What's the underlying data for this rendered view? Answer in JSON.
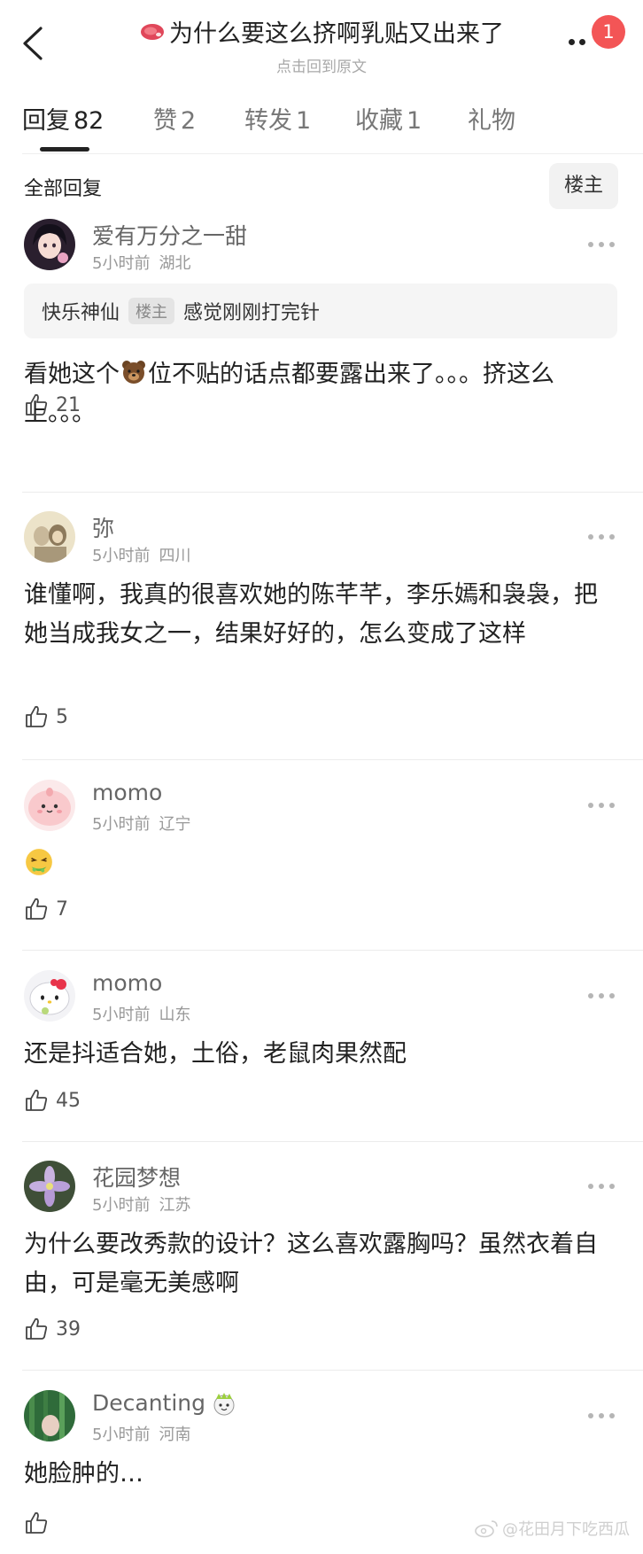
{
  "header": {
    "title": "为什么要这么挤啊乳贴又出来了",
    "subtitle": "点击回到原文",
    "notification_count": "1"
  },
  "tabs": [
    {
      "label": "回复",
      "count": "82"
    },
    {
      "label": "赞",
      "count": "2"
    },
    {
      "label": "转发",
      "count": "1"
    },
    {
      "label": "收藏",
      "count": "1"
    },
    {
      "label": "礼物",
      "count": ""
    }
  ],
  "section": {
    "title": "全部回复",
    "filter_label": "楼主"
  },
  "comments": [
    {
      "username": "爱有万分之一甜",
      "time": "5小时前",
      "location": "湖北",
      "quote": {
        "author": "快乐神仙",
        "badge": "楼主",
        "text": "感觉刚刚打完针"
      },
      "text_before": "看她这个",
      "text_after": "位不贴的话点都要露出来了。。。挤这么上。。。",
      "likes": "21"
    },
    {
      "username": "弥",
      "time": "5小时前",
      "location": "四川",
      "text": "谁懂啊，我真的很喜欢她的陈芊芊，李乐嫣和袅袅，把她当成我女之一，结果好好的，怎么变成了这样",
      "likes": "5"
    },
    {
      "username": "momo",
      "time": "5小时前",
      "location": "辽宁",
      "text": "",
      "likes": "7"
    },
    {
      "username": "momo",
      "time": "5小时前",
      "location": "山东",
      "text": "还是抖适合她，土俗，老鼠肉果然配",
      "likes": "45"
    },
    {
      "username": "花园梦想",
      "time": "5小时前",
      "location": "江苏",
      "text": "为什么要改秀款的设计？这么喜欢露胸吗？虽然衣着自由，可是毫无美感啊",
      "likes": "39"
    },
    {
      "username": "Decanting",
      "time": "5小时前",
      "location": "河南",
      "text": "她脸肿的…",
      "likes": ""
    }
  ],
  "watermark": "@花田月下吃西瓜",
  "colors": {
    "badge_red": "#f35556",
    "text_primary": "#222222",
    "text_secondary": "#999999"
  },
  "icons": [
    "back-arrow-icon",
    "steak-emoji-icon",
    "more-icon",
    "thumbs-up-icon",
    "bear-emoji-icon",
    "vomit-emoji-icon",
    "crown-badge-icon",
    "weibo-logo-icon"
  ]
}
